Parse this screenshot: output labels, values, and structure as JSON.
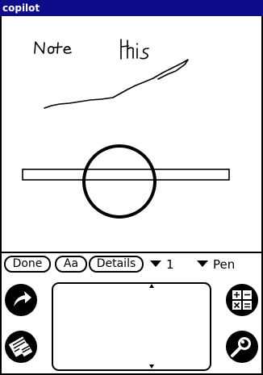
{
  "window": {
    "title": "copilot"
  },
  "canvas": {
    "handwriting": "Note This"
  },
  "toolbar": {
    "done_label": "Done",
    "font_label": "Aa",
    "details_label": "Details",
    "page_value": "1",
    "tool_value": "Pen"
  },
  "silkscreen": {
    "icons": [
      "home-icon",
      "menu-icon",
      "calculator-icon",
      "find-icon"
    ]
  }
}
